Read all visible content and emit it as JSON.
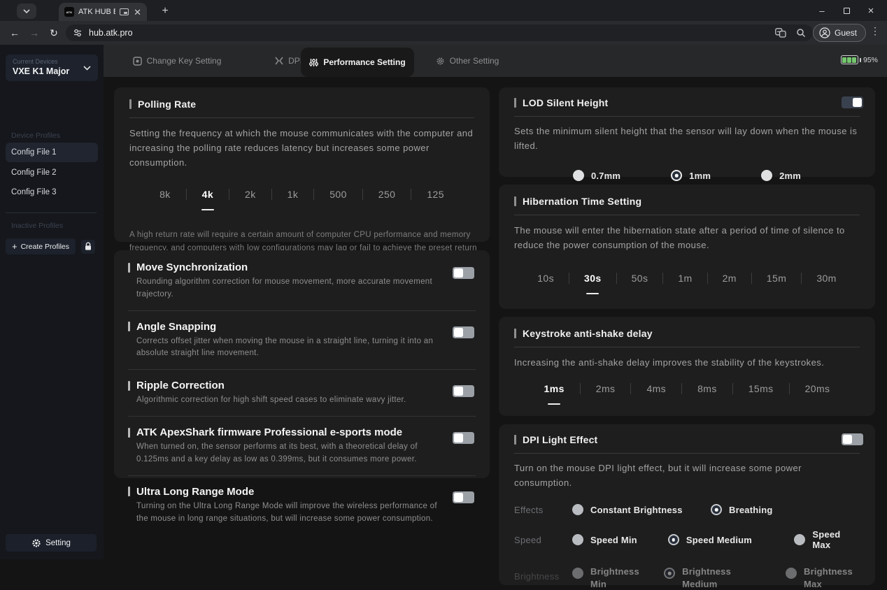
{
  "browser": {
    "favicon_text": "ATK",
    "tab_title": "ATK HUB Beta",
    "url": "hub.atk.pro",
    "guest_label": "Guest"
  },
  "sidebar": {
    "current_devices_label": "Current Devices",
    "device_name": "VXE K1 Major",
    "device_profiles_label": "Device Profiles",
    "profiles": [
      "Config File 1",
      "Config File 2",
      "Config File 3"
    ],
    "active_profile": "Config File 1",
    "inactive_profiles_label": "Inactive Profiles",
    "create_profiles_label": "Create Profiles",
    "setting_label": "Setting"
  },
  "tabs": {
    "items": [
      {
        "label": "Change Key Setting"
      },
      {
        "label": "DPI Setting"
      },
      {
        "label": "Performance Setting"
      },
      {
        "label": "Other Setting"
      }
    ],
    "active": "Performance Setting",
    "battery_percent": "95%"
  },
  "polling": {
    "title": "Polling Rate",
    "description": "Setting the frequency at which the mouse communicates with the computer and increasing the polling rate reduces latency but increases some power consumption.",
    "options": [
      "8k",
      "4k",
      "2k",
      "1k",
      "500",
      "250",
      "125"
    ],
    "selected": "4k",
    "note": "A high return rate will require a certain amount of computer CPU performance and memory frequency, and computers with low configurations may lag or fail to achieve the preset return rate."
  },
  "switches": {
    "items": [
      {
        "title": "Move Synchronization",
        "description": "Rounding algorithm correction for mouse movement, more accurate movement trajectory.",
        "state": "off"
      },
      {
        "title": "Angle Snapping",
        "description": "Corrects offset jitter when moving the mouse in a straight line, turning it into an absolute straight line movement.",
        "state": "off"
      },
      {
        "title": "Ripple Correction",
        "description": "Algorithmic correction for high shift speed cases to eliminate wavy jitter.",
        "state": "off"
      },
      {
        "title": "ATK ApexShark firmware Professional e-sports mode",
        "description": "When turned on, the sensor performs at its best, with a theoretical delay of 0.125ms and a key delay as low as 0.399ms, but it consumes more power.",
        "state": "off"
      },
      {
        "title": "Ultra Long Range Mode",
        "description": "Turning on the Ultra Long Range Mode will improve the wireless performance of the mouse in long range situations, but will increase some power consumption.",
        "state": "off"
      }
    ]
  },
  "lod": {
    "title": "LOD Silent Height",
    "toggle_state": "on",
    "description": "Sets the minimum silent height that the sensor will lay down when the mouse is lifted.",
    "options": [
      "0.7mm",
      "1mm",
      "2mm"
    ],
    "selected": "1mm"
  },
  "hibernation": {
    "title": "Hibernation Time Setting",
    "description": "The mouse will enter the hibernation state after a period of time of silence to reduce the power consumption of the mouse.",
    "options": [
      "10s",
      "30s",
      "50s",
      "1m",
      "2m",
      "15m",
      "30m"
    ],
    "selected": "30s"
  },
  "keystroke": {
    "title": "Keystroke anti-shake delay",
    "description": "Increasing the anti-shake delay improves the stability of the keystrokes.",
    "options": [
      "1ms",
      "2ms",
      "4ms",
      "8ms",
      "15ms",
      "20ms"
    ],
    "selected": "1ms"
  },
  "dpi_light": {
    "title": "DPI Light Effect",
    "toggle_state": "off",
    "description": "Turn on the mouse DPI light effect, but it will increase some power consumption.",
    "effects": {
      "label": "Effects",
      "options": [
        "Constant Brightness",
        "Breathing"
      ],
      "selected": "Breathing"
    },
    "speed": {
      "label": "Speed",
      "options": [
        "Speed Min",
        "Speed Medium",
        "Speed Max"
      ],
      "selected": "Speed Medium"
    },
    "brightness": {
      "label": "Brightness",
      "options": [
        "Brightness Min",
        "Brightness Medium",
        "Brightness Max"
      ],
      "selected": "Brightness Medium",
      "disabled": true
    }
  },
  "colors": {
    "accent_green": "#74c76e",
    "card_bg": "#1e1e1e",
    "sidebar_bg": "#15171c",
    "toggle_on_track": "#3a414e",
    "toggle_off_track": "#9aa0a6"
  }
}
